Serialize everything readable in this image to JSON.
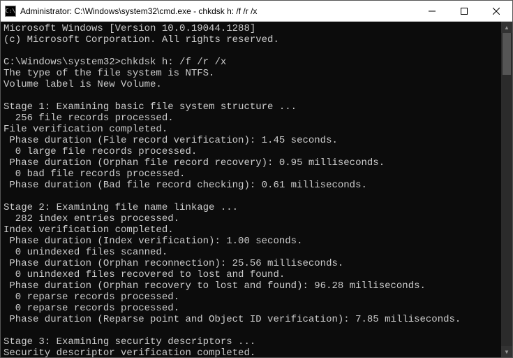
{
  "titlebar": {
    "icon_label": "C:\\",
    "title": "Administrator: C:\\Windows\\system32\\cmd.exe - chkdsk  h: /f /r /x"
  },
  "terminal": {
    "lines": [
      "Microsoft Windows [Version 10.0.19044.1288]",
      "(c) Microsoft Corporation. All rights reserved.",
      "",
      "C:\\Windows\\system32>chkdsk h: /f /r /x",
      "The type of the file system is NTFS.",
      "Volume label is New Volume.",
      "",
      "Stage 1: Examining basic file system structure ...",
      "  256 file records processed.",
      "File verification completed.",
      " Phase duration (File record verification): 1.45 seconds.",
      "  0 large file records processed.",
      " Phase duration (Orphan file record recovery): 0.95 milliseconds.",
      "  0 bad file records processed.",
      " Phase duration (Bad file record checking): 0.61 milliseconds.",
      "",
      "Stage 2: Examining file name linkage ...",
      "  282 index entries processed.",
      "Index verification completed.",
      " Phase duration (Index verification): 1.00 seconds.",
      "  0 unindexed files scanned.",
      " Phase duration (Orphan reconnection): 25.56 milliseconds.",
      "  0 unindexed files recovered to lost and found.",
      " Phase duration (Orphan recovery to lost and found): 96.28 milliseconds.",
      "  0 reparse records processed.",
      "  0 reparse records processed.",
      " Phase duration (Reparse point and Object ID verification): 7.85 milliseconds.",
      "",
      "Stage 3: Examining security descriptors ...",
      "Security descriptor verification completed."
    ]
  }
}
